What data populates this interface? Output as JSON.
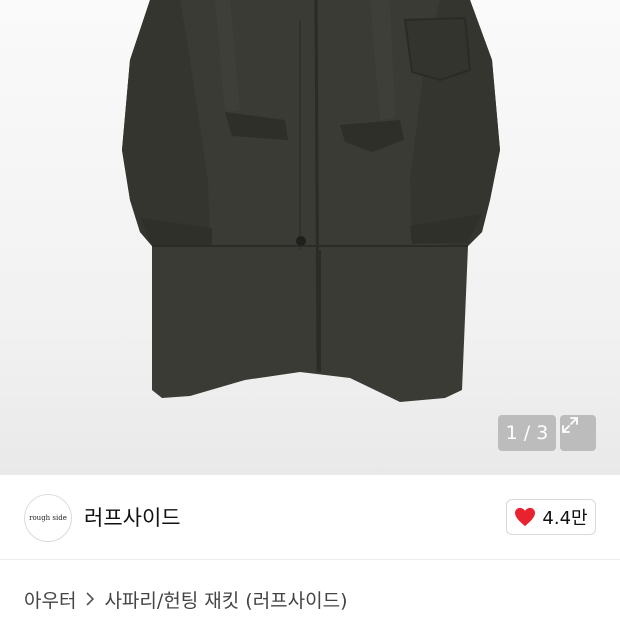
{
  "gallery": {
    "counter": "1 / 3",
    "image_alt": "product-photo-coat",
    "expand_icon": "expand-icon"
  },
  "brand": {
    "logo_text": "rough side",
    "name": "러프사이드"
  },
  "like": {
    "icon": "heart-icon",
    "color": "#e8232f",
    "count": "4.4만"
  },
  "breadcrumb": {
    "category": "아우터",
    "separator_icon": "chevron-right-icon",
    "product": "사파리/헌팅 재킷 (러프사이드)"
  }
}
